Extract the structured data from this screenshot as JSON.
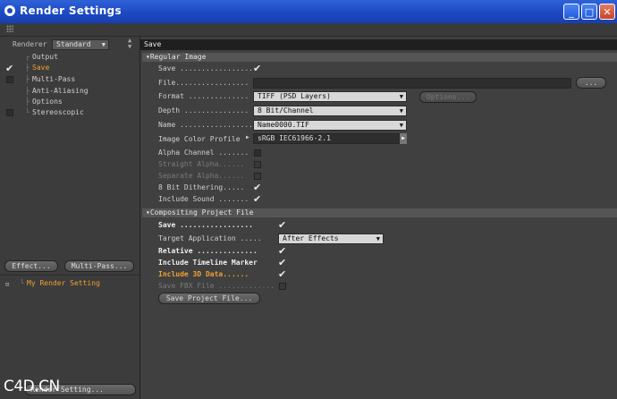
{
  "window": {
    "title": "Render Settings",
    "controls": {
      "minimize": "_",
      "maximize": "□",
      "close": "✕"
    }
  },
  "sidebar": {
    "renderer_label": "Renderer",
    "renderer_value": "Standard",
    "items": [
      {
        "label": "Output",
        "checked": null
      },
      {
        "label": "Save",
        "checked": true,
        "active": true
      },
      {
        "label": "Multi-Pass",
        "checked": false
      },
      {
        "label": "Anti-Aliasing",
        "checked": null
      },
      {
        "label": "Options",
        "checked": null
      },
      {
        "label": "Stereoscopic",
        "checked": false
      }
    ],
    "effect_button": "Effect...",
    "multipass_button": "Multi-Pass...",
    "setting_name": "My Render Setting",
    "bottom_button": "Render Setting..."
  },
  "panel": {
    "header": "Save",
    "regular": {
      "title": "Regular Image",
      "save_label": "Save .................",
      "file_label": "File.................",
      "format_label": "Format ..............",
      "format_value": "TIFF (PSD Layers)",
      "options_button": "Options...",
      "depth_label": "Depth ...............",
      "depth_value": "8 Bit/Channel",
      "name_label": "Name .................",
      "name_value": "Name0000.TIF",
      "profile_label": "Image Color Profile",
      "profile_value": "sRGB IEC61966-2.1",
      "alpha_label": "Alpha Channel .......",
      "straight_label": "Straight Alpha......",
      "separate_label": "Separate Alpha......",
      "dither_label": "8 Bit Dithering.....",
      "sound_label": "Include Sound ......."
    },
    "compositing": {
      "title": "Compositing Project File",
      "save_label": "Save .................",
      "target_label": "Target Application .....",
      "target_value": "After Effects",
      "relative_label": "Relative ..............",
      "timeline_label": "Include Timeline Marker",
      "data3d_label": "Include 3D Data......",
      "fbx_label": "Save FBX File .............",
      "save_button": "Save Project File..."
    }
  },
  "watermark": "C4D.CN"
}
